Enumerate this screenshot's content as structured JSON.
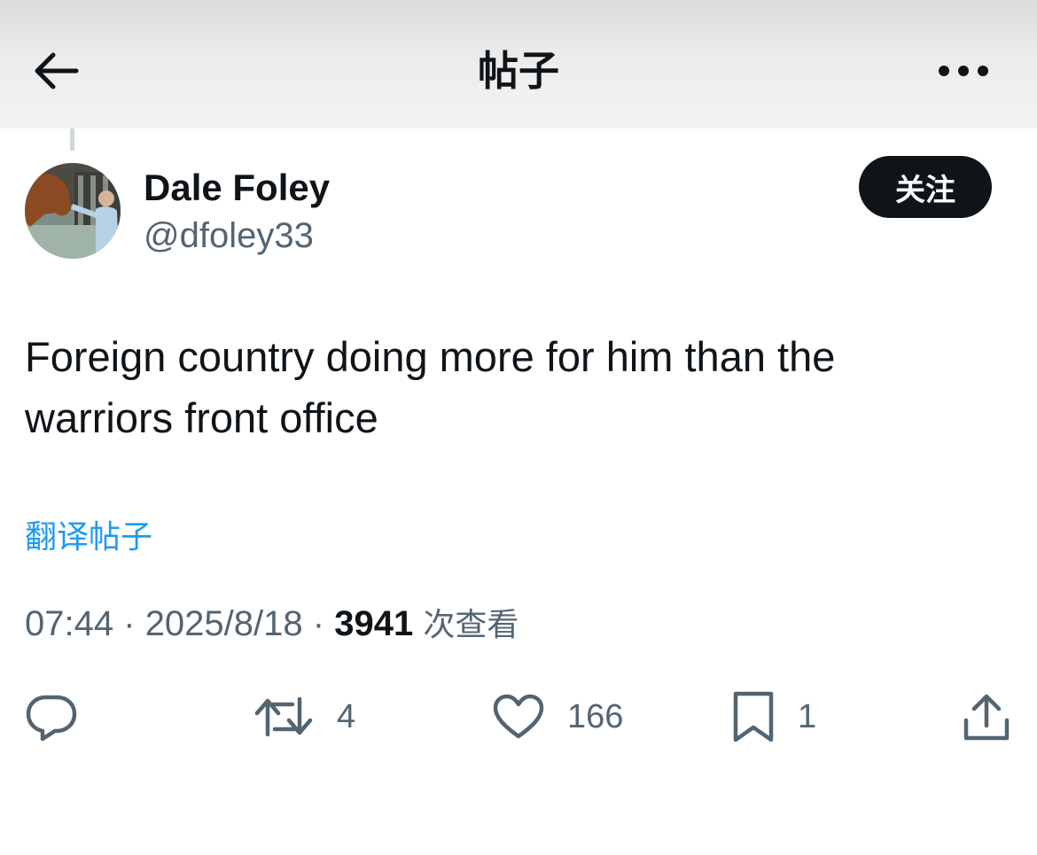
{
  "header": {
    "title": "帖子",
    "back_icon": "arrow-left-icon",
    "more_icon": "more-horizontal-icon"
  },
  "author": {
    "display_name": "Dale Foley",
    "handle": "@dfoley33",
    "follow_label": "关注"
  },
  "tweet": {
    "text_line1": "Foreign country doing more for him than the",
    "text_line2": "warriors front office",
    "translate_label": "翻译帖子"
  },
  "meta": {
    "time": "07:44",
    "separator": "·",
    "date": "2025/8/18",
    "views_count": "3941",
    "views_label": "次查看"
  },
  "actions": {
    "reply_icon": "reply-icon",
    "retweet_icon": "retweet-icon",
    "retweet_count": "4",
    "like_icon": "heart-icon",
    "like_count": "166",
    "bookmark_icon": "bookmark-icon",
    "bookmark_count": "1",
    "share_icon": "share-icon"
  },
  "colors": {
    "text_primary": "#0f1419",
    "text_secondary": "#536471",
    "link": "#1d9bf0",
    "follow_bg": "#0f1419"
  }
}
